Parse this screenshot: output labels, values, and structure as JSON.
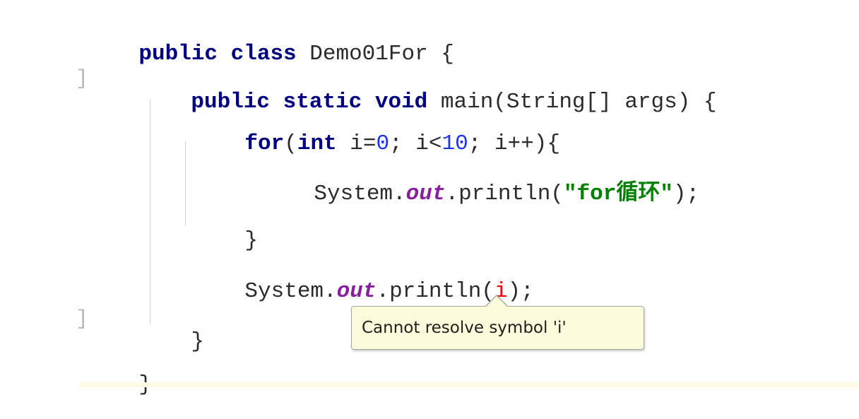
{
  "editor": {
    "background": "#ffffff",
    "font_size_px": 31,
    "colors": {
      "keyword": "#000080",
      "plain_text": "#2b2b2b",
      "number_literal": "#1d35f5",
      "static_field": "#871f9e",
      "string_literal": "#008000",
      "error_symbol": "#ff0000",
      "indent_guide": "#d4d4d4",
      "fold_marker": "#b9b9b9",
      "tooltip_background": "#fcfbdb",
      "tooltip_border": "#a8a8a0",
      "bottom_band": "#fefae6"
    },
    "lines": [
      {
        "id": "line-class-declaration",
        "tokens": [
          {
            "text": "public class ",
            "type": "keyword"
          },
          {
            "text": "Demo01For {",
            "type": "plain"
          }
        ]
      },
      {
        "id": "line-main-method-declaration",
        "tokens": [
          {
            "text": "public static void ",
            "type": "keyword"
          },
          {
            "text": "main(String[] args) {",
            "type": "plain"
          }
        ]
      },
      {
        "id": "line-for-statement",
        "tokens": [
          {
            "text": "for",
            "type": "keyword"
          },
          {
            "text": "(",
            "type": "plain"
          },
          {
            "text": "int",
            "type": "keyword"
          },
          {
            "text": " i=",
            "type": "plain"
          },
          {
            "text": "0",
            "type": "number"
          },
          {
            "text": "; i<",
            "type": "plain"
          },
          {
            "text": "10",
            "type": "number"
          },
          {
            "text": "; i++){",
            "type": "plain"
          }
        ]
      },
      {
        "id": "line-println-string",
        "tokens": [
          {
            "text": "System.",
            "type": "plain"
          },
          {
            "text": "out",
            "type": "field"
          },
          {
            "text": ".println(",
            "type": "plain"
          },
          {
            "text": "\"for循环\"",
            "type": "string"
          },
          {
            "text": ");",
            "type": "plain"
          }
        ]
      },
      {
        "id": "line-for-closing-brace",
        "tokens": [
          {
            "text": "}",
            "type": "plain"
          }
        ]
      },
      {
        "id": "line-println-i",
        "tokens": [
          {
            "text": "System.",
            "type": "plain"
          },
          {
            "text": "out",
            "type": "field"
          },
          {
            "text": ".println(",
            "type": "plain"
          },
          {
            "text": "i",
            "type": "error"
          },
          {
            "text": ");",
            "type": "plain"
          }
        ]
      },
      {
        "id": "line-main-closing-brace",
        "tokens": [
          {
            "text": "}",
            "type": "plain"
          }
        ]
      },
      {
        "id": "line-class-closing-brace",
        "tokens": [
          {
            "text": "}",
            "type": "plain"
          }
        ]
      }
    ],
    "fold_markers": [
      {
        "glyph": "]",
        "label": "fold-marker-method"
      },
      {
        "glyph": "]",
        "label": "fold-marker-method-end"
      }
    ]
  },
  "tooltip": {
    "message": "Cannot resolve symbol 'i'"
  }
}
